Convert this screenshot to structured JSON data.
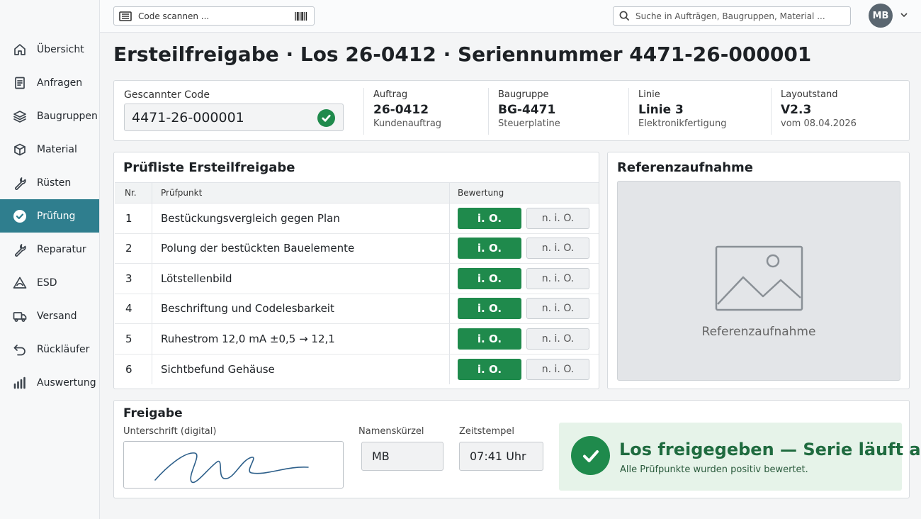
{
  "topbar": {
    "scan_label": "Code scannen ...",
    "search_placeholder": "Suche in Aufträgen, Baugruppen, Material ...",
    "user_initials": "MB"
  },
  "sidebar": {
    "items": [
      {
        "label": "Übersicht",
        "icon": "home-icon"
      },
      {
        "label": "Anfragen",
        "icon": "document-icon"
      },
      {
        "label": "Baugruppen",
        "icon": "layers-icon"
      },
      {
        "label": "Material",
        "icon": "box-icon"
      },
      {
        "label": "Rüsten",
        "icon": "wrench-icon"
      },
      {
        "label": "Prüfung",
        "icon": "check-circle-icon",
        "active": true
      },
      {
        "label": "Reparatur",
        "icon": "wrench-icon"
      },
      {
        "label": "ESD",
        "icon": "esd-warning-icon"
      },
      {
        "label": "Versand",
        "icon": "truck-icon"
      },
      {
        "label": "Rückläufer",
        "icon": "return-icon"
      },
      {
        "label": "Auswertung",
        "icon": "bar-chart-icon"
      }
    ]
  },
  "page": {
    "title": "Ersteilfreigabe · Los 26-0412 · Seriennummer 4471-26-000001"
  },
  "scan": {
    "label": "Gescannter Code",
    "value": "4471-26-000001"
  },
  "info": [
    {
      "key": "Auftrag",
      "value": "26-0412",
      "sub": "Kundenauftrag"
    },
    {
      "key": "Baugruppe",
      "value": "BG-4471",
      "sub": "Steuerplatine"
    },
    {
      "key": "Linie",
      "value": "Linie 3",
      "sub": "Elektronikfertigung"
    },
    {
      "key": "Layoutstand",
      "value": "V2.3",
      "sub": "vom 08.04.2026"
    }
  ],
  "checklist": {
    "title": "Prüfliste Ersteilfreigabe",
    "headers": {
      "nr": "Nr.",
      "item": "Prüfpunkt",
      "rating": "Bewertung"
    },
    "ok_label": "i. O.",
    "nok_label": "n. i. O.",
    "rows": [
      {
        "nr": "1",
        "item": "Bestückungsvergleich gegen Plan",
        "rating": "i. O."
      },
      {
        "nr": "2",
        "item": "Polung der bestückten Bauelemente",
        "rating": "i. O."
      },
      {
        "nr": "3",
        "item": "Lötstellenbild",
        "rating": "i. O."
      },
      {
        "nr": "4",
        "item": "Beschriftung und Codelesbarkeit",
        "rating": "i. O."
      },
      {
        "nr": "5",
        "item": "Ruhestrom 12,0 mA ±0,5 → 12,1",
        "rating": "i. O."
      },
      {
        "nr": "6",
        "item": "Sichtbefund Gehäuse",
        "rating": "i. O."
      }
    ]
  },
  "reference": {
    "title": "Referenzaufnahme",
    "caption": "Referenzaufnahme"
  },
  "release": {
    "title": "Freigabe",
    "signature_label": "Unterschrift (digital)",
    "initials_label": "Namenskürzel",
    "initials_value": "MB",
    "timestamp_label": "Zeitstempel",
    "timestamp_value": "07:41 Uhr",
    "status_title": "Los freigegeben — Serie läuft an",
    "status_sub": "Alle Prüfpunkte wurden positiv bewertet."
  },
  "colors": {
    "accent": "#2f7e8e",
    "ok_green": "#1f8a4c",
    "success_bg": "#e6f3e9"
  }
}
